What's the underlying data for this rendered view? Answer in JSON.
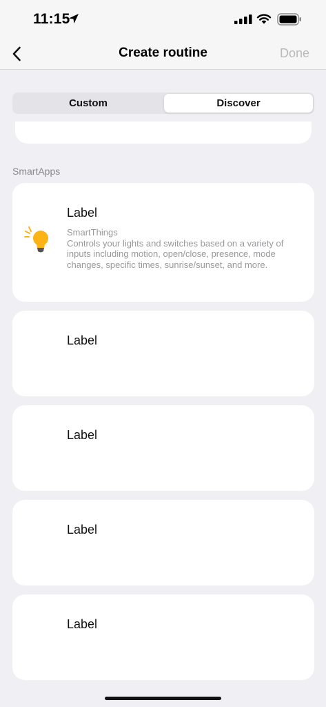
{
  "status_bar": {
    "time": "11:15",
    "icons": [
      "location-arrow-icon",
      "cellular-signal-icon",
      "wifi-icon",
      "battery-icon"
    ]
  },
  "nav": {
    "back_icon": "chevron-left-icon",
    "title": "Create routine",
    "done_label": "Done"
  },
  "segmented": {
    "options": [
      "Custom",
      "Discover"
    ],
    "selected": "Discover"
  },
  "section": {
    "title": "SmartApps"
  },
  "cards": [
    {
      "label": "Label",
      "icon": "lightbulb-icon",
      "publisher": "SmartThings",
      "description": "Controls your lights and switches based on a variety of inputs including motion, open/close, presence, mode changes, specific times, sunrise/sunset, and more."
    },
    {
      "label": "Label"
    },
    {
      "label": "Label"
    },
    {
      "label": "Label"
    },
    {
      "label": "Label"
    }
  ],
  "colors": {
    "background": "#f0eff4",
    "bulb": "#fbb316",
    "disabled_text": "#b9b9bc"
  }
}
